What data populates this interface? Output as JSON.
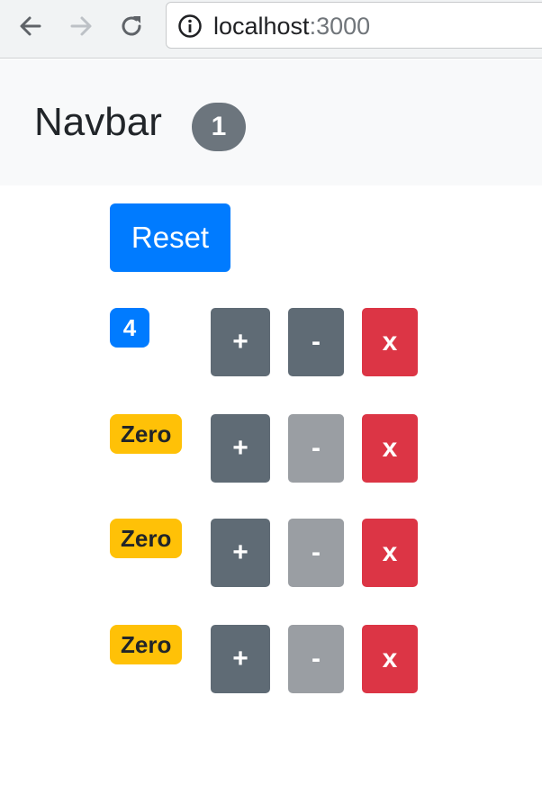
{
  "browser": {
    "url_host": "localhost",
    "url_port": ":3000"
  },
  "navbar": {
    "brand": "Navbar",
    "total_count": "1"
  },
  "reset_label": "Reset",
  "counters": [
    {
      "badge": "4",
      "badge_color": "#007bff",
      "inc_label": "+",
      "dec_label": "-",
      "delete_label": "x",
      "dec_disabled": false
    },
    {
      "badge": "Zero",
      "badge_color": "#ffc107",
      "inc_label": "+",
      "dec_label": "-",
      "delete_label": "x",
      "dec_disabled": true
    },
    {
      "badge": "Zero",
      "badge_color": "#ffc107",
      "inc_label": "+",
      "dec_label": "-",
      "delete_label": "x",
      "dec_disabled": true
    },
    {
      "badge": "Zero",
      "badge_color": "#ffc107",
      "inc_label": "+",
      "dec_label": "-",
      "delete_label": "x",
      "dec_disabled": true
    }
  ],
  "colors": {
    "primary": "#007bff",
    "secondary": "#6c757d",
    "warning": "#ffc107",
    "danger": "#dc3545"
  }
}
